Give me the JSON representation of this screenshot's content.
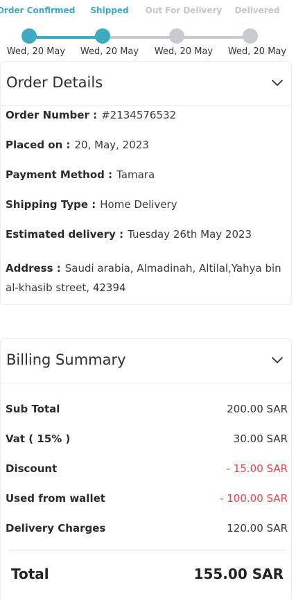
{
  "tracker": {
    "steps": [
      {
        "label": "Order Confirmed",
        "date": "Wed, 20 May",
        "state": "done"
      },
      {
        "label": "Shipped",
        "date": "Wed, 20 May",
        "state": "done"
      },
      {
        "label": "Out For Delivery",
        "date": "Wed, 20 May",
        "state": "pending"
      },
      {
        "label": "Delivered",
        "date": "Wed, 20 May",
        "state": "pending"
      }
    ],
    "colors": {
      "active": "#3fa9c0",
      "inactive": "#c9cbcf",
      "inactive_label": "#c3c5c8"
    }
  },
  "order_details": {
    "title": "Order Details",
    "chevron": "chevron-down-icon",
    "rows": [
      {
        "key": "Order Number :",
        "value": "#2134576532"
      },
      {
        "key": "Placed on :",
        "value": "20, May, 2023"
      },
      {
        "key": "Payment Method :",
        "value": "Tamara"
      },
      {
        "key": "Shipping Type :",
        "value": "Home Delivery"
      },
      {
        "key": "Estimated delivery :",
        "value": "Tuesday 26th May 2023"
      }
    ],
    "address": {
      "key": "Address :",
      "value": "Saudi arabia, Almadinah, Altilal,Yahya bin al-khasib street, 42394"
    }
  },
  "billing": {
    "title": "Billing Summary",
    "chevron": "chevron-down-icon",
    "rows": [
      {
        "key": "Sub Total",
        "value": "200.00 SAR"
      },
      {
        "key": "Vat ( 15% )",
        "value": "30.00 SAR"
      },
      {
        "key": "Discount",
        "value": "- 15.00 SAR"
      },
      {
        "key": "Used from wallet",
        "value": "- 100.00 SAR"
      },
      {
        "key": "Delivery Charges",
        "value": "120.00 SAR"
      }
    ],
    "total_label": "Total",
    "total_value": "155.00 SAR",
    "negative_color": "#e5484d"
  }
}
